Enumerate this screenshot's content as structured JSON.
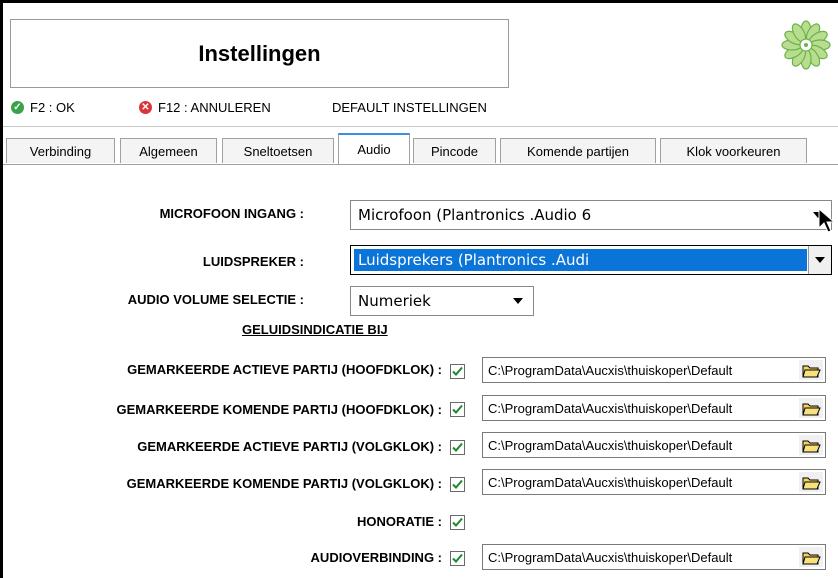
{
  "window": {
    "title": "Instellingen"
  },
  "toolbar": {
    "ok_label": "F2 : OK",
    "cancel_label": "F12 : ANNULEREN",
    "defaults_label": "DEFAULT INSTELLINGEN"
  },
  "tabs": [
    {
      "label": "Verbinding"
    },
    {
      "label": "Algemeen"
    },
    {
      "label": "Sneltoetsen"
    },
    {
      "label": "Audio",
      "active": true
    },
    {
      "label": "Pincode"
    },
    {
      "label": "Komende partijen"
    },
    {
      "label": "Klok voorkeuren"
    }
  ],
  "audio": {
    "microphone_label": "MICROFOON INGANG :",
    "microphone_value": "Microfoon (Plantronics .Audio 6",
    "speaker_label": "LUIDSPREKER :",
    "speaker_value": "Luidsprekers (Plantronics .Audi",
    "volume_label": "AUDIO VOLUME SELECTIE :",
    "volume_value": "Numeriek",
    "section_heading": "GELUIDSINDICATIE BIJ",
    "rows": [
      {
        "label": "GEMARKEERDE ACTIEVE PARTIJ (HOOFDKLOK) :",
        "checked": true,
        "path": "C:\\ProgramData\\Aucxis\\thuiskoper\\Default"
      },
      {
        "label": "GEMARKEERDE KOMENDE PARTIJ (HOOFDKLOK) :",
        "checked": true,
        "path": "C:\\ProgramData\\Aucxis\\thuiskoper\\Default"
      },
      {
        "label": "GEMARKEERDE ACTIEVE PARTIJ (VOLGKLOK) :",
        "checked": true,
        "path": "C:\\ProgramData\\Aucxis\\thuiskoper\\Default"
      },
      {
        "label": "GEMARKEERDE KOMENDE PARTIJ (VOLGKLOK) :",
        "checked": true,
        "path": "C:\\ProgramData\\Aucxis\\thuiskoper\\Default"
      },
      {
        "label": "HONORATIE :",
        "checked": true
      },
      {
        "label": "AUDIOVERBINDING :",
        "checked": true,
        "path": "C:\\ProgramData\\Aucxis\\thuiskoper\\Default"
      }
    ]
  },
  "colors": {
    "ok": "#3aa34a",
    "cancel": "#d9353a",
    "active_tab": "#3d8ee0",
    "selection": "#0a74d8",
    "check": "#1a8a2a"
  }
}
